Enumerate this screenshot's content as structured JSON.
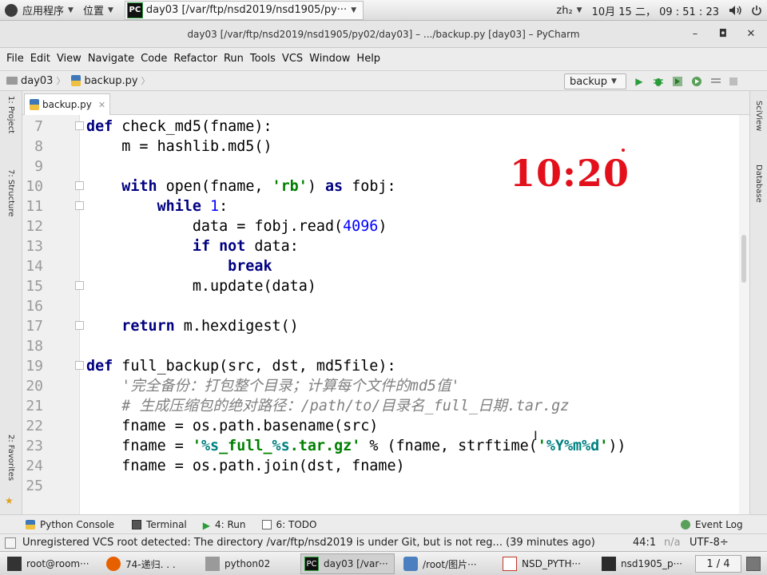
{
  "system_panel": {
    "apps_label": "应用程序",
    "places_label": "位置",
    "active_task_label": "day03 [/var/ftp/nsd2019/nsd1905/py···",
    "input_method": "zh₂",
    "datetime": "10月 15 二， 09 : 51 : 23"
  },
  "window": {
    "title": "day03 [/var/ftp/nsd2019/nsd1905/py02/day03] – .../backup.py [day03] – PyCharm"
  },
  "menu": [
    "File",
    "Edit",
    "View",
    "Navigate",
    "Code",
    "Refactor",
    "Run",
    "Tools",
    "VCS",
    "Window",
    "Help"
  ],
  "navbar": {
    "project": "day03",
    "file": "backup.py",
    "run_config": "backup"
  },
  "left_stripe": {
    "project_tab": "1: Project",
    "structure_tab": "7: Structure",
    "favorites_tab": "2: Favorites"
  },
  "right_stripe": {
    "sciview_tab": "SciView",
    "database_tab": "Database"
  },
  "editor": {
    "tab": "backup.py",
    "overlay_time": "10:20",
    "line_numbers": [
      "7",
      "8",
      "9",
      "10",
      "11",
      "12",
      "13",
      "14",
      "15",
      "16",
      "17",
      "18",
      "19",
      "20",
      "21",
      "22",
      "23",
      "24",
      "25"
    ]
  },
  "code": {
    "l7": {
      "kw": "def",
      "rest": " check_md5(fname):"
    },
    "l8": {
      "text": "    m = hashlib.md5()"
    },
    "l10": {
      "indent": "    ",
      "kw1": "with",
      "mid1": " open(fname, ",
      "str": "'rb'",
      "mid2": ") ",
      "kw2": "as",
      "rest": " fobj:"
    },
    "l11": {
      "indent": "        ",
      "kw": "while",
      "sp": " ",
      "num": "1",
      "rest": ":"
    },
    "l12": {
      "pre": "            data = fobj.read(",
      "num": "4096",
      "rest": ")"
    },
    "l13": {
      "indent": "            ",
      "kw1": "if",
      "sp": " ",
      "kw2": "not",
      "rest": " data:"
    },
    "l14": {
      "indent": "                ",
      "kw": "break"
    },
    "l15": {
      "text": "            m.update(data)"
    },
    "l17": {
      "indent": "    ",
      "kw": "return",
      "rest": " m.hexdigest()"
    },
    "l19": {
      "kw": "def",
      "rest": " full_backup(src, dst, md5file):"
    },
    "l20": {
      "indent": "    ",
      "doc": "'完全备份：打包整个目录；计算每个文件的md5值'"
    },
    "l21": {
      "indent": "    ",
      "comment": "# 生成压缩包的绝对路径：/path/to/目录名_full_日期.tar.gz"
    },
    "l22": {
      "text": "    fname = os.path.basename(src)"
    },
    "l23": {
      "pre": "    fname = ",
      "s1": "'",
      "f1": "%s",
      "s2": "_full_",
      "f2": "%s",
      "s3": ".tar.gz'",
      "mid": " % (fname, strftime(",
      "s4": "'",
      "f3": "%Y%m%d",
      "s5": "'",
      "rest": "))"
    },
    "l24": {
      "text": "    fname = os.path.join(dst, fname)"
    }
  },
  "tool_windows": {
    "python_console": "Python Console",
    "terminal": "Terminal",
    "run": "4: Run",
    "todo": "6: TODO",
    "event_log": "Event Log"
  },
  "status": {
    "message": "Unregistered VCS root detected: The directory /var/ftp/nsd2019 is under Git, but is not reg... (39 minutes ago)",
    "position": "44:1",
    "na": "n/a",
    "encoding": "UTF-8÷"
  },
  "taskbar": {
    "items": [
      "root@room···",
      "74-递归. . .",
      "python02",
      "day03 [/var···",
      "/root/图片···",
      "NSD_PYTH···",
      "nsd1905_p···"
    ],
    "pager": "1 / 4"
  },
  "colors": {
    "keyword": "#000080",
    "string": "#008000",
    "number": "#0000ff",
    "comment": "#808080",
    "overlay": "#e3101b"
  }
}
